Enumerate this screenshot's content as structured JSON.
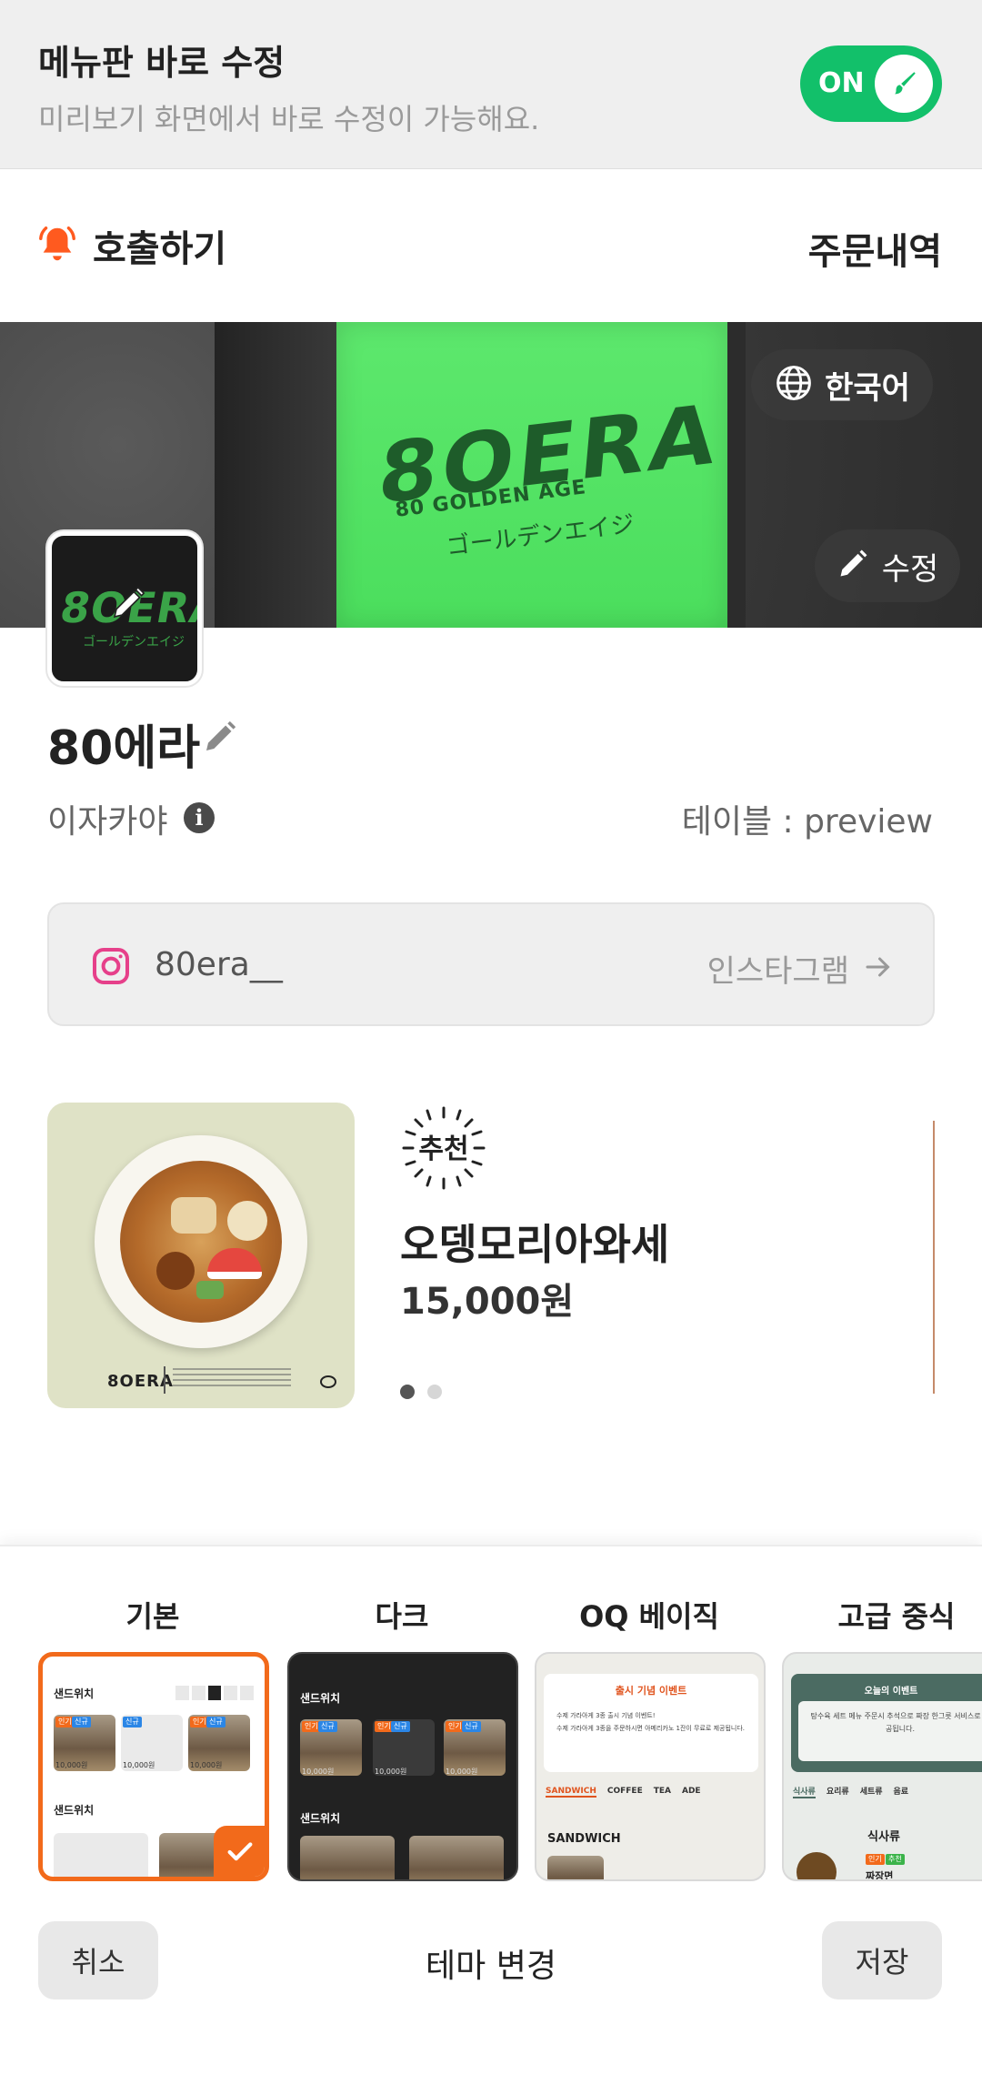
{
  "edit_banner": {
    "title": "메뉴판 바로 수정",
    "subtitle": "미리보기 화면에서 바로 수정이 가능해요.",
    "toggle_label": "ON",
    "toggle_on": true
  },
  "header": {
    "call_label": "호출하기",
    "orders_label": "주문내역"
  },
  "hero": {
    "language_label": "한국어",
    "edit_label": "수정",
    "sign_logo": "8OERA",
    "sign_sub": "80 GOLDEN AGE",
    "sign_jp": "ゴールデンエイジ"
  },
  "store": {
    "logo_text": "8OERA",
    "logo_jp": "ゴールデンエイジ",
    "name": "80에라",
    "type": "이자카야",
    "table": "테이블 : preview",
    "instagram_handle": "80era__",
    "instagram_link_label": "인스타그램"
  },
  "promo": {
    "badge": "추천",
    "name": "오뎅모리아와세",
    "price": "15,000원",
    "footer_logo": "8OERA",
    "slide_count": 2,
    "active_slide": 0
  },
  "theme_sheet": {
    "tabs": [
      "기본",
      "다크",
      "OQ 베이직",
      "고급 중식"
    ],
    "selected_index": 0,
    "cancel_label": "취소",
    "title": "테마 변경",
    "save_label": "저장",
    "accent_color": "#f26a1b",
    "basic": {
      "section": "샌드위치",
      "tag_hot": "인기",
      "tag_new": "신규",
      "price": "10,000원"
    },
    "dark": {
      "section": "샌드위치",
      "tag_hot": "인기",
      "tag_new": "신규",
      "price": "10,000원"
    },
    "oq": {
      "event_title": "출시 기념 이벤트",
      "event_line1": "수제 가라아게 3종 출시 기념 이벤트!",
      "event_line2": "수제 가라아게 3종을 주문하시면 아메리카노 1잔이 무료로 제공됩니다.",
      "tabs": [
        "SANDWICH",
        "COFFEE",
        "TEA",
        "ADE"
      ],
      "section": "SANDWICH"
    },
    "chinese": {
      "event_title": "오늘의 이벤트",
      "event_text": "탕수육 세트 메뉴 주문시 추석으로 짜장 한그릇 서비스로 제공됩니다.",
      "tabs": [
        "식사류",
        "요리류",
        "세트류",
        "음료"
      ],
      "section": "식사류",
      "item": "짜장면",
      "tag_hot": "인기",
      "tag_new": "추천"
    }
  }
}
